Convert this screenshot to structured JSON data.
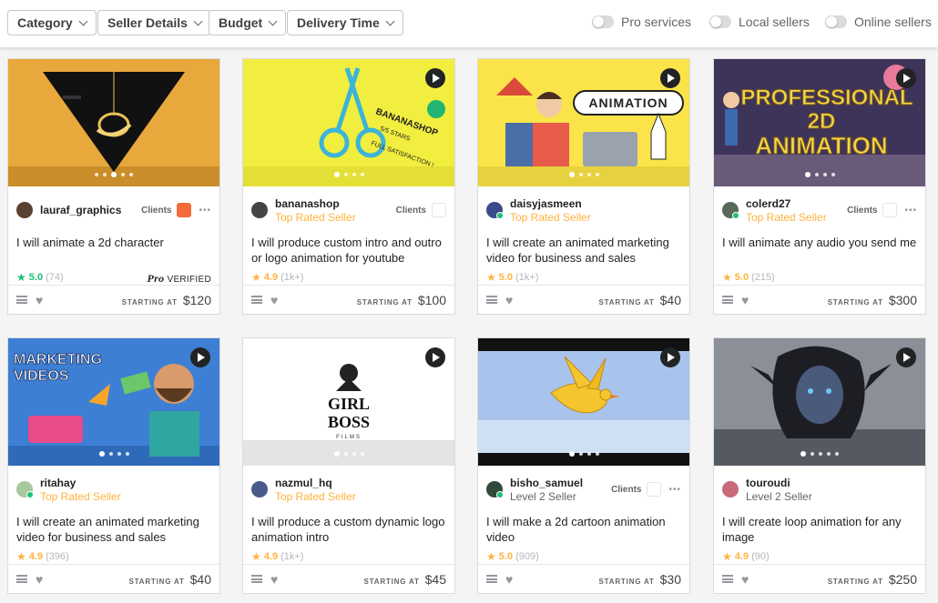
{
  "filters": [
    {
      "label": "Category"
    },
    {
      "label": "Seller Details"
    },
    {
      "label": "Budget"
    },
    {
      "label": "Delivery Time"
    }
  ],
  "toggles": [
    {
      "label": "Pro services",
      "on": false
    },
    {
      "label": "Local sellers",
      "on": false
    },
    {
      "label": "Online sellers",
      "on": false
    }
  ],
  "colors": {
    "accent": "#1dbf73",
    "top_rated": "#ffb33e",
    "star": "#ffb33e"
  },
  "cards": [
    {
      "seller": "lauraf_graphics",
      "level": "",
      "clients": "Clients",
      "title": "I will animate a 2d character",
      "score": "5.0",
      "reviews": "(74)",
      "pro_label": "VERIFIED",
      "pro_brand": "Pro",
      "price_label": "STARTING AT",
      "price": "$120"
    },
    {
      "seller": "bananashop",
      "level": "Top Rated Seller",
      "clients": "Clients",
      "title": "I will produce custom intro and outro or logo animation for youtube",
      "score": "4.9",
      "reviews": "(1k+)",
      "price_label": "STARTING AT",
      "price": "$100",
      "thumb_text": [
        "BANANASHOP",
        "5/5 STARS",
        "FULL SATISFACTION !"
      ]
    },
    {
      "seller": "daisyjasmeen",
      "level": "Top Rated Seller",
      "clients": "",
      "title": "I will create an animated marketing video for business and sales",
      "score": "5.0",
      "reviews": "(1k+)",
      "price_label": "STARTING AT",
      "price": "$40",
      "thumb_text": [
        "ANIMATION"
      ]
    },
    {
      "seller": "colerd27",
      "level": "Top Rated Seller",
      "clients": "Clients",
      "title": "I will animate any audio you send me",
      "score": "5.0",
      "reviews": "(215)",
      "price_label": "STARTING AT",
      "price": "$300",
      "thumb_text": [
        "PROFESSIONAL",
        "2D",
        "ANIMATION"
      ]
    },
    {
      "seller": "ritahay",
      "level": "Top Rated Seller",
      "clients": "",
      "title": "I will create an animated marketing video for business and sales",
      "score": "4.9",
      "reviews": "(396)",
      "price_label": "STARTING AT",
      "price": "$40",
      "thumb_text": [
        "MARKETING",
        "VIDEOS"
      ]
    },
    {
      "seller": "nazmul_hq",
      "level": "Top Rated Seller",
      "clients": "",
      "title": "I will produce a custom dynamic logo animation intro",
      "score": "4.9",
      "reviews": "(1k+)",
      "price_label": "STARTING AT",
      "price": "$45",
      "thumb_text": [
        "GIRL",
        "BOSS",
        "FILMS"
      ]
    },
    {
      "seller": "bisho_samuel",
      "level": "Level 2 Seller",
      "clients": "Clients",
      "title": "I will make a 2d cartoon animation video",
      "score": "5.0",
      "reviews": "(909)",
      "price_label": "STARTING AT",
      "price": "$30"
    },
    {
      "seller": "touroudi",
      "level": "Level 2 Seller",
      "clients": "",
      "title": "I will create loop animation for any image",
      "score": "4.9",
      "reviews": "(90)",
      "price_label": "STARTING AT",
      "price": "$250"
    }
  ]
}
